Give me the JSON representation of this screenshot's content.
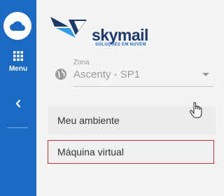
{
  "sidebar": {
    "logo_icon": "cloud-icon",
    "menu_icon": "grid-icon",
    "menu_label": "Menu",
    "collapse_icon": "chevron-left-icon",
    "bg_color": "#1b69c2"
  },
  "brand": {
    "name": "skymail",
    "tagline": "SOLUÇÕES EM NUVEM"
  },
  "zone": {
    "label": "Zona",
    "value": "Ascenty - SP1",
    "icon": "globe-icon"
  },
  "nav": {
    "items": [
      {
        "label": "Meu ambiente"
      },
      {
        "label": "Máquina virtual",
        "highlighted": true
      }
    ]
  },
  "colors": {
    "accent": "#1b69c2",
    "highlight_border": "#c0323b"
  }
}
